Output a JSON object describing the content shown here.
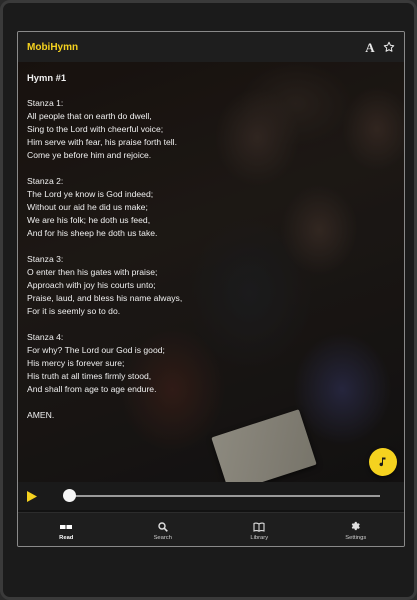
{
  "app": {
    "title": "MobiHymn",
    "icons": [
      "font-size-icon",
      "star-icon"
    ]
  },
  "hymn": {
    "title": "Hymn #1",
    "stanzas": [
      {
        "label": "Stanza 1:",
        "lines": [
          "All people that on earth do dwell,",
          "Sing to the Lord with cheerful voice;",
          "Him serve with fear, his praise forth tell.",
          "Come ye before him and rejoice."
        ]
      },
      {
        "label": "Stanza 2:",
        "lines": [
          "The Lord ye know is God indeed;",
          "Without our aid he did us make;",
          "We are his folk; he doth us feed,",
          "And for his sheep he doth us take."
        ]
      },
      {
        "label": "Stanza 3:",
        "lines": [
          "O enter then his gates with praise;",
          "Approach with joy his courts unto;",
          "Praise, laud, and bless his name always,",
          "For it is seemly so to do."
        ]
      },
      {
        "label": "Stanza 4:",
        "lines": [
          "For why? The Lord our God is good;",
          "His mercy is forever sure;",
          "His truth at all times firmly stood,",
          "And shall from age to age endure."
        ]
      }
    ],
    "closing": "AMEN."
  },
  "player": {
    "progress": 0.0,
    "play_icon": "play-icon",
    "fab_icon": "music-note-icon"
  },
  "nav": {
    "items": [
      {
        "label": "Read",
        "icon": "read-icon",
        "active": true
      },
      {
        "label": "Search",
        "icon": "search-icon",
        "active": false
      },
      {
        "label": "Library",
        "icon": "library-icon",
        "active": false
      },
      {
        "label": "Settings",
        "icon": "settings-icon",
        "active": false
      }
    ]
  },
  "colors": {
    "accent": "#f5d21f",
    "background": "#121212",
    "appbar": "#1e1e1e",
    "text": "#f0f0f0"
  }
}
